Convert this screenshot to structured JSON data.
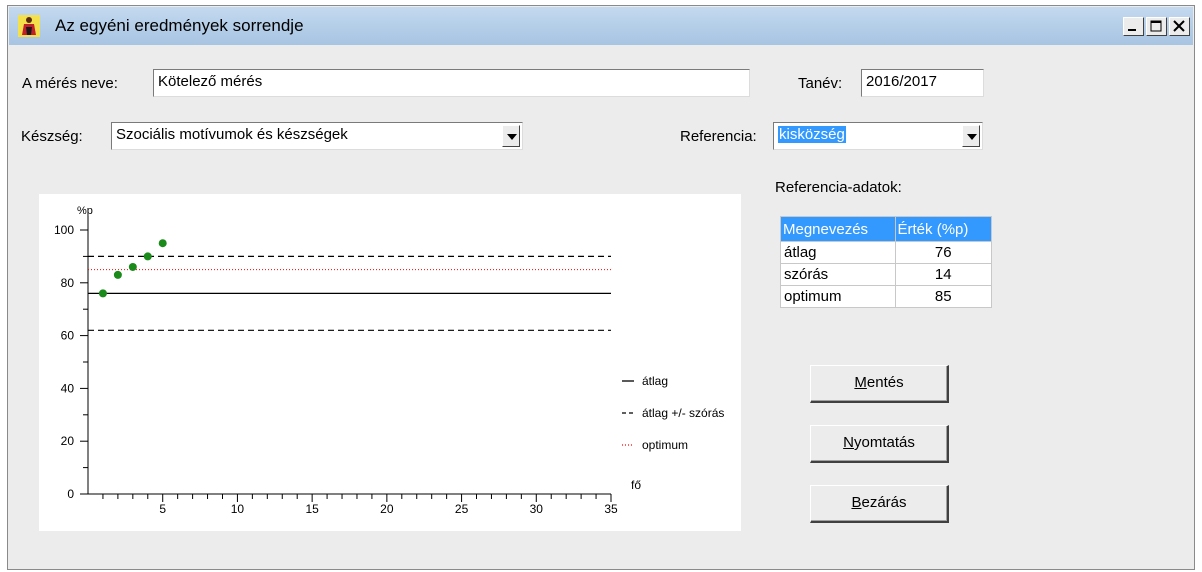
{
  "window": {
    "title": "Az egyéni eredmények sorrendje",
    "icon": "app-figure-icon"
  },
  "form": {
    "measure_label": "A mérés neve:",
    "measure_value": "Kötelező mérés",
    "year_label": "Tanév:",
    "year_value": "2016/2017",
    "skill_label": "Készség:",
    "skill_value": "Szociális motívumok és készségek",
    "reference_label": "Referencia:",
    "reference_value": "kisközség"
  },
  "reference": {
    "heading": "Referencia-adatok:",
    "columns": [
      "Megnevezés",
      "Érték (%p)"
    ],
    "rows": [
      {
        "name": "átlag",
        "value": "76"
      },
      {
        "name": "szórás",
        "value": "14"
      },
      {
        "name": "optimum",
        "value": "85"
      }
    ]
  },
  "buttons": {
    "save": {
      "accel": "M",
      "rest": "entés"
    },
    "print": {
      "accel": "N",
      "rest": "yomtatás"
    },
    "close": {
      "accel": "B",
      "rest": "ezárás"
    }
  },
  "chart_data": {
    "type": "scatter",
    "ylabel": "%p",
    "xlabel": "fő",
    "xlim": [
      0,
      35
    ],
    "ylim": [
      0,
      100
    ],
    "xticks": [
      5,
      10,
      15,
      20,
      25,
      30,
      35
    ],
    "yticks": [
      0,
      20,
      40,
      60,
      80,
      100
    ],
    "points": [
      {
        "x": 1,
        "y": 76
      },
      {
        "x": 2,
        "y": 83
      },
      {
        "x": 3,
        "y": 86
      },
      {
        "x": 4,
        "y": 90
      },
      {
        "x": 5,
        "y": 95
      }
    ],
    "mean": 76,
    "std": 14,
    "optimum": 85,
    "point_color": "#1a8a1a",
    "optimum_color": "#ff0000",
    "legend": [
      {
        "label": "átlag",
        "style": "solid"
      },
      {
        "label": "átlag +/- szórás",
        "style": "dashed"
      },
      {
        "label": "optimum",
        "style": "dotted"
      }
    ]
  }
}
